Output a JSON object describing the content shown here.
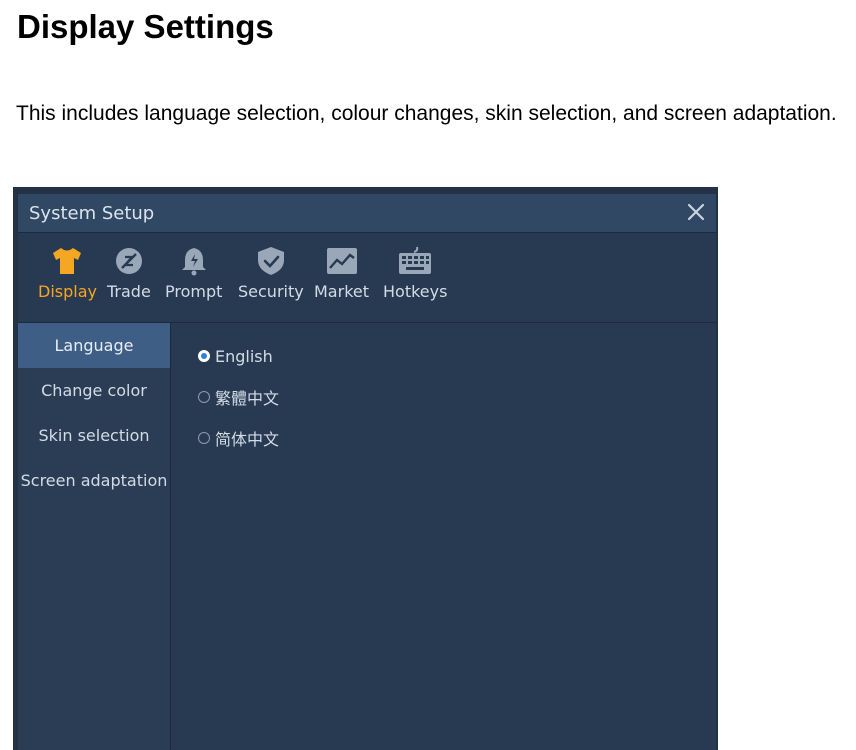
{
  "document": {
    "title": "Display Settings",
    "description": "This includes language selection, colour changes, skin selection, and screen adaptation."
  },
  "dialog": {
    "title": "System Setup",
    "close_icon": "close-icon",
    "tabs": [
      {
        "label": "Display",
        "icon": "shirt-icon",
        "active": true
      },
      {
        "label": "Trade",
        "icon": "trade-icon",
        "active": false
      },
      {
        "label": "Prompt",
        "icon": "bell-icon",
        "active": false
      },
      {
        "label": "Security",
        "icon": "shield-icon",
        "active": false
      },
      {
        "label": "Market",
        "icon": "chart-icon",
        "active": false
      },
      {
        "label": "Hotkeys",
        "icon": "keyboard-icon",
        "active": false
      }
    ],
    "sidebar": [
      {
        "label": "Language",
        "active": true
      },
      {
        "label": "Change color",
        "active": false
      },
      {
        "label": "Skin selection",
        "active": false
      },
      {
        "label": "Screen adaptation",
        "active": false
      }
    ],
    "language_options": [
      {
        "label": "English",
        "checked": true
      },
      {
        "label": "繁體中文",
        "checked": false
      },
      {
        "label": "简体中文",
        "checked": false
      }
    ]
  },
  "colors": {
    "accent": "#f5a623",
    "selected_item": "#3f5e85",
    "radio_dot": "#3a7bd5"
  }
}
